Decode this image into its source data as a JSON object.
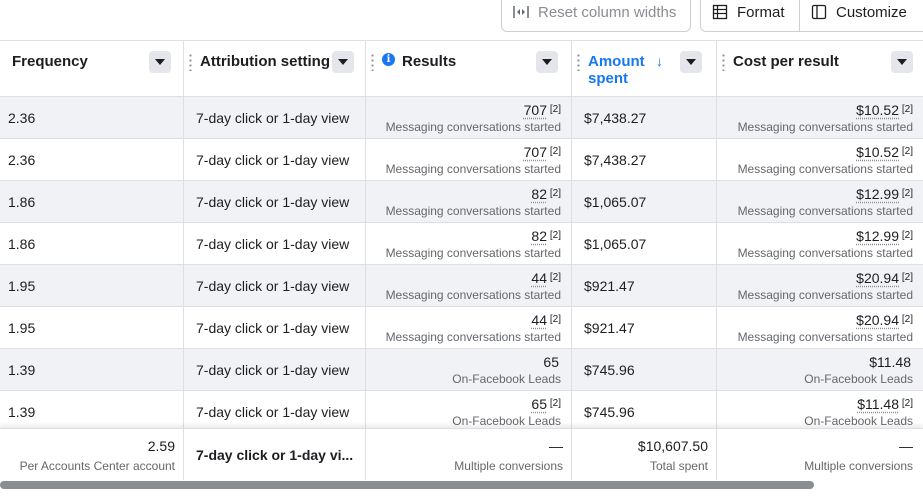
{
  "toolbar": {
    "reset_label": "Reset column widths",
    "format_label": "Format",
    "customize_label": "Customize"
  },
  "columns": {
    "frequency": "Frequency",
    "attribution": "Attribution setting",
    "results": "Results",
    "amount_spent_line1": "Amount",
    "amount_spent_line2": "spent",
    "cost_per_result": "Cost per result"
  },
  "rows": [
    {
      "frequency": "2.36",
      "attribution": "7-day click or 1-day view",
      "results": "707",
      "results_fn": "[2]",
      "results_sub": "Messaging conversations started",
      "amount": "$7,438.27",
      "cpr": "$10.52",
      "cpr_fn": "[2]",
      "cpr_sub": "Messaging conversations started"
    },
    {
      "frequency": "2.36",
      "attribution": "7-day click or 1-day view",
      "results": "707",
      "results_fn": "[2]",
      "results_sub": "Messaging conversations started",
      "amount": "$7,438.27",
      "cpr": "$10.52",
      "cpr_fn": "[2]",
      "cpr_sub": "Messaging conversations started"
    },
    {
      "frequency": "1.86",
      "attribution": "7-day click or 1-day view",
      "results": "82",
      "results_fn": "[2]",
      "results_sub": "Messaging conversations started",
      "amount": "$1,065.07",
      "cpr": "$12.99",
      "cpr_fn": "[2]",
      "cpr_sub": "Messaging conversations started"
    },
    {
      "frequency": "1.86",
      "attribution": "7-day click or 1-day view",
      "results": "82",
      "results_fn": "[2]",
      "results_sub": "Messaging conversations started",
      "amount": "$1,065.07",
      "cpr": "$12.99",
      "cpr_fn": "[2]",
      "cpr_sub": "Messaging conversations started"
    },
    {
      "frequency": "1.95",
      "attribution": "7-day click or 1-day view",
      "results": "44",
      "results_fn": "[2]",
      "results_sub": "Messaging conversations started",
      "amount": "$921.47",
      "cpr": "$20.94",
      "cpr_fn": "[2]",
      "cpr_sub": "Messaging conversations started"
    },
    {
      "frequency": "1.95",
      "attribution": "7-day click or 1-day view",
      "results": "44",
      "results_fn": "[2]",
      "results_sub": "Messaging conversations started",
      "amount": "$921.47",
      "cpr": "$20.94",
      "cpr_fn": "[2]",
      "cpr_sub": "Messaging conversations started"
    },
    {
      "frequency": "1.39",
      "attribution": "7-day click or 1-day view",
      "results": "65",
      "results_fn": "",
      "results_sub": "On-Facebook Leads",
      "amount": "$745.96",
      "cpr": "$11.48",
      "cpr_fn": "",
      "cpr_sub": "On-Facebook Leads"
    },
    {
      "frequency": "1.39",
      "attribution": "7-day click or 1-day view",
      "results": "65",
      "results_fn": "[2]",
      "results_sub": "On-Facebook Leads",
      "amount": "$745.96",
      "cpr": "$11.48",
      "cpr_fn": "[2]",
      "cpr_sub": "On-Facebook Leads"
    }
  ],
  "footer": {
    "frequency": "2.59",
    "frequency_sub": "Per Accounts Center account",
    "attribution": "7-day click or 1-day vi...",
    "results": "—",
    "results_sub": "Multiple conversions",
    "amount": "$10,607.50",
    "amount_sub": "Total spent",
    "cpr": "—",
    "cpr_sub": "Multiple conversions"
  },
  "colors": {
    "accent": "#1877f2",
    "row_shade": "#f0f2f5",
    "border": "#dddfe2",
    "muted_text": "#65676b"
  }
}
